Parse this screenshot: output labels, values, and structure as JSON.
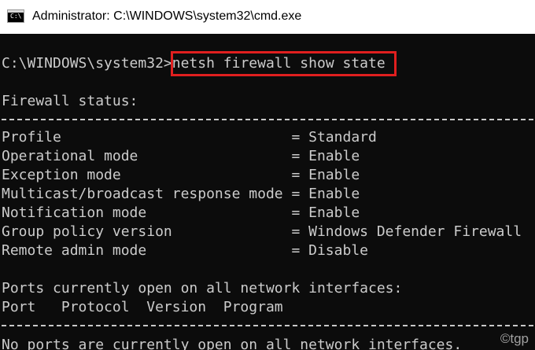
{
  "window": {
    "title": "Administrator: C:\\WINDOWS\\system32\\cmd.exe",
    "icon": "cmd-icon"
  },
  "console": {
    "prompt": "C:\\WINDOWS\\system32>",
    "command": "netsh firewall show state",
    "firewall_status_heading": "Firewall status:",
    "rows": [
      {
        "text": "Profile                           = Standard"
      },
      {
        "text": "Operational mode                  = Enable"
      },
      {
        "text": "Exception mode                    = Enable"
      },
      {
        "text": "Multicast/broadcast response mode = Enable"
      },
      {
        "text": "Notification mode                 = Enable"
      },
      {
        "text": "Group policy version              = Windows Defender Firewall"
      },
      {
        "text": "Remote admin mode                 = Disable"
      }
    ],
    "ports_heading": "Ports currently open on all network interfaces:",
    "ports_columns": "Port   Protocol  Version  Program",
    "ports_message": "No ports are currently open on all network interfaces."
  },
  "watermark": "©tgp",
  "colors": {
    "console_bg": "#0c0c0c",
    "console_text": "#cccccc",
    "highlight": "#e01f1f",
    "titlebar_bg": "#ffffff"
  }
}
